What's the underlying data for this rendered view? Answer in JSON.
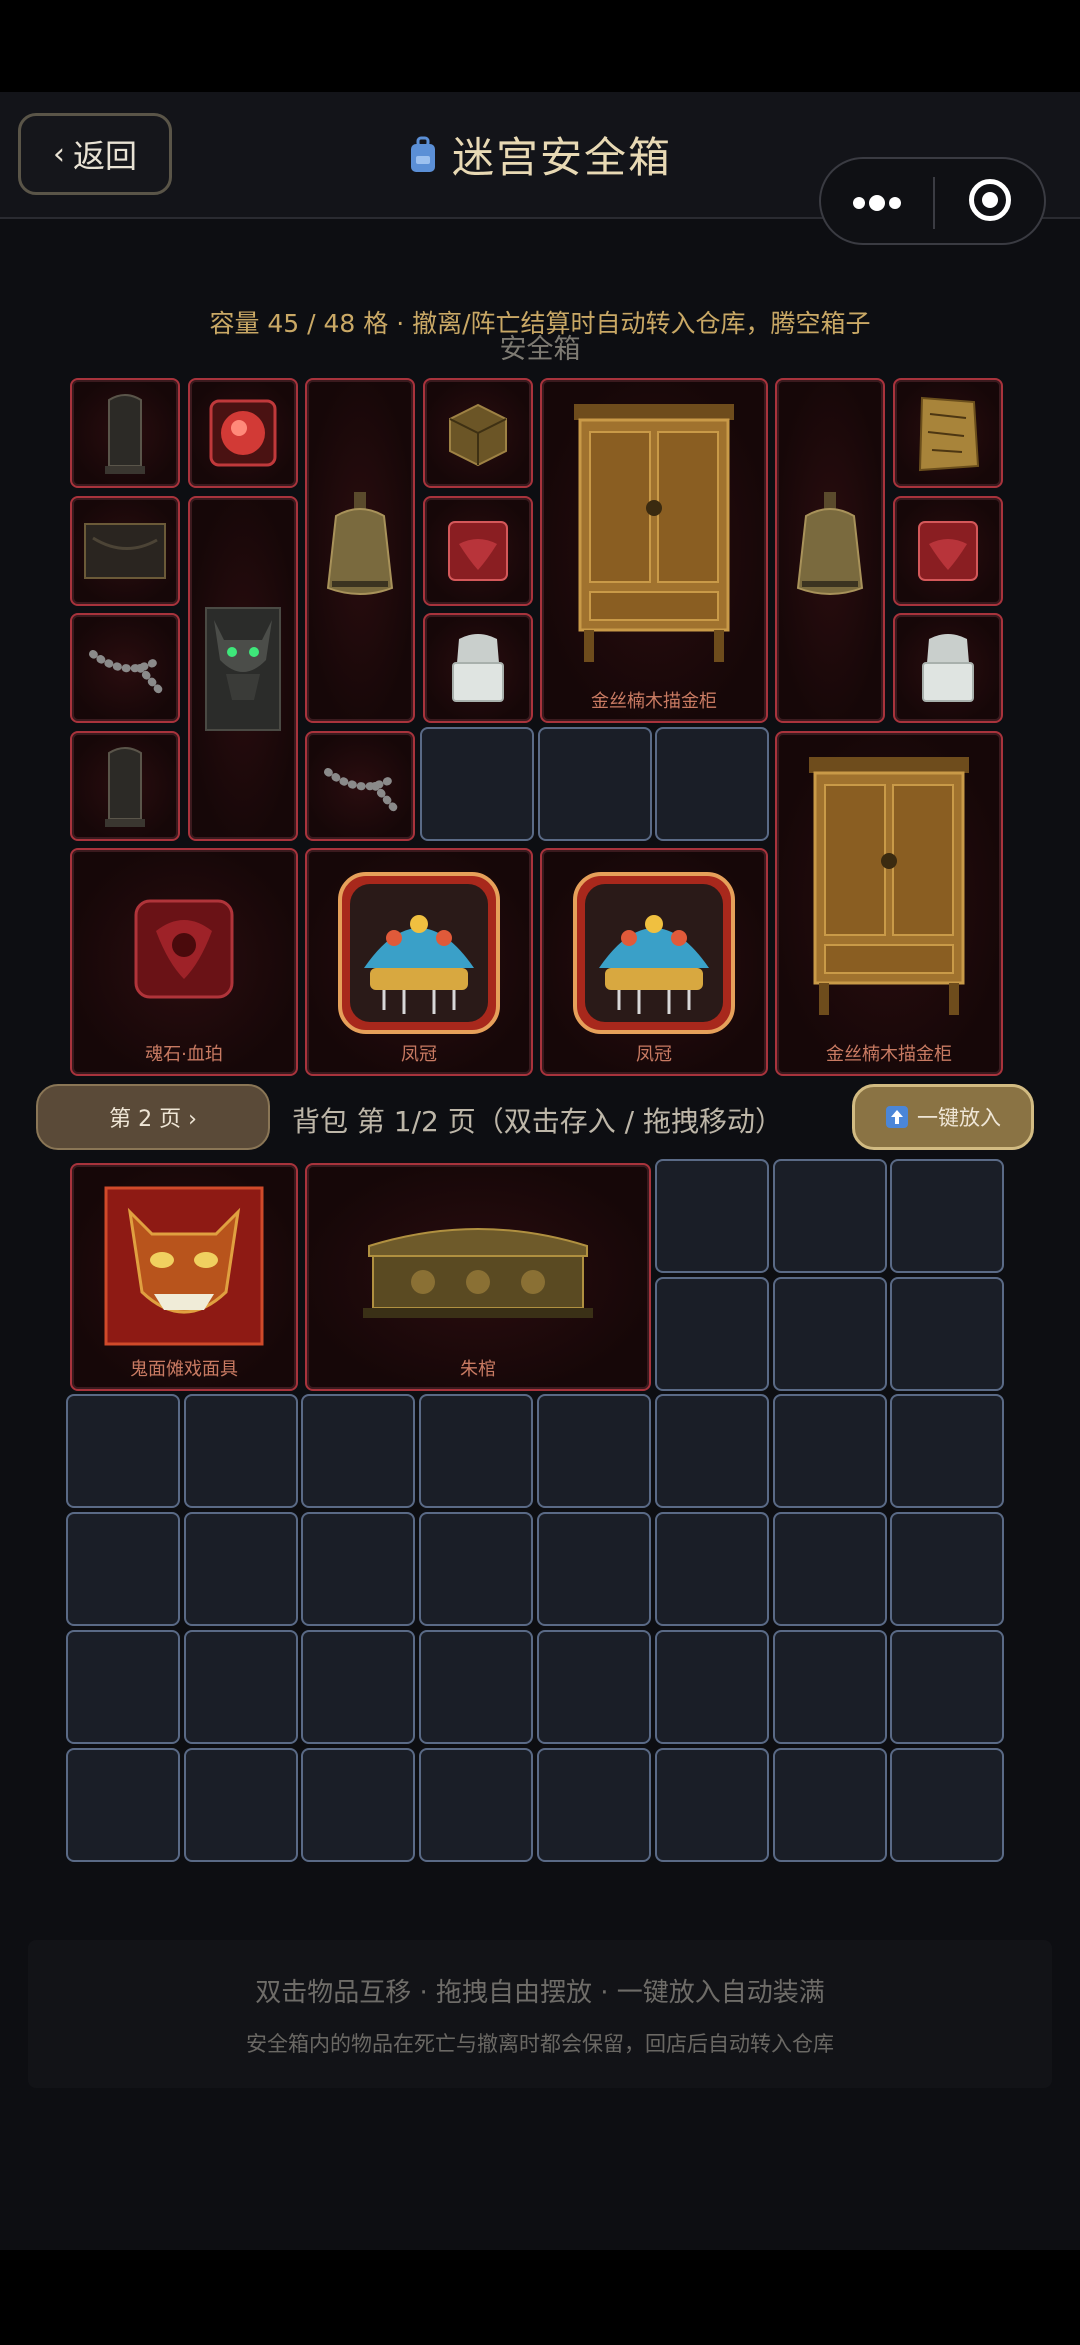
{
  "header": {
    "back_label": "返回",
    "title": "迷宫安全箱"
  },
  "safe": {
    "capacity_text": "容量 45 / 48 格 · 撤离/阵亡结算时自动转入仓库，腾空箱子",
    "title": "安全箱",
    "items": {
      "cabinet_1_label": "金丝楠木描金柜",
      "soulstone_label": "魂石·血珀",
      "crown_1_label": "凤冠",
      "crown_2_label": "凤冠",
      "cabinet_2_label": "金丝楠木描金柜"
    }
  },
  "backpack": {
    "page_button": "第 2 页 ›",
    "title": "背包 第 1/2 页（双击存入 / 拖拽移动）",
    "one_click_button": "一键放入",
    "items": {
      "mask_label": "鬼面傩戏面具",
      "coffin_label": "朱棺"
    }
  },
  "footer": {
    "line1": "双击物品互移 · 拖拽自由摆放 · 一键放入自动装满",
    "line2": "安全箱内的物品在死亡与撤离时都会保留，回店后自动转入仓库"
  },
  "colors": {
    "accent_gold": "#c9a865",
    "item_border": "#a8333c",
    "empty_border": "#5a6a86"
  }
}
